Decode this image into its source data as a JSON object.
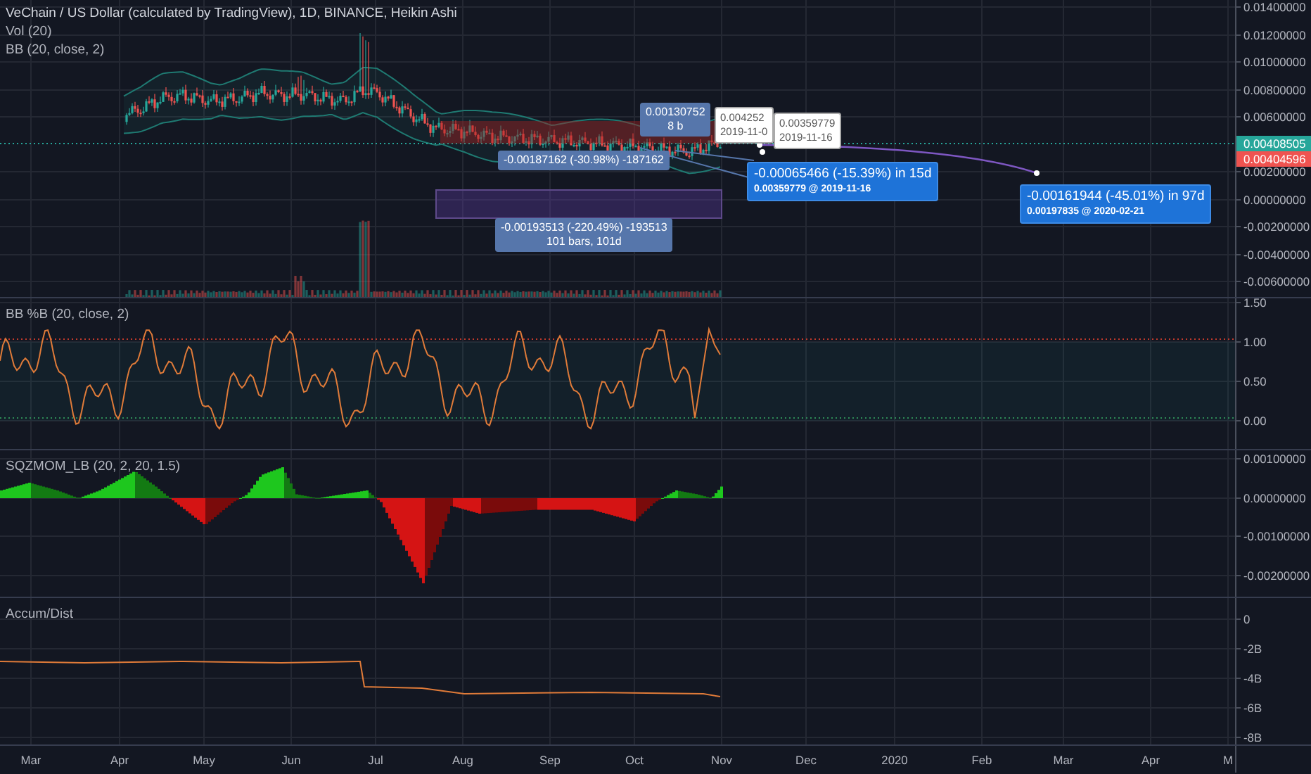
{
  "legend": {
    "title": "VeChain / US Dollar (calculated by TradingView), 1D, BINANCE, Heikin Ashi",
    "studies": [
      "Vol (20)",
      "BB (20, close, 2)"
    ]
  },
  "panes": [
    {
      "kind": "price",
      "axis_labels": [
        "0.01400000",
        "0.01200000",
        "0.01000000",
        "0.00800000",
        "0.00600000",
        "0.00200000",
        "0.00000000",
        "-0.00200000",
        "-0.00400000",
        "-0.00600000"
      ],
      "price_tags": [
        {
          "text": "0.00408505",
          "color": "#26a69a"
        },
        {
          "text": "0.00404596",
          "color": "#ef5350"
        }
      ]
    },
    {
      "kind": "percent_b",
      "title": "BB %B (20, close, 2)",
      "axis_labels": [
        "1.50",
        "1.00",
        "0.50",
        "0.00"
      ]
    },
    {
      "kind": "squeeze",
      "title": "SQZMOM_LB (20, 2, 20, 1.5)",
      "axis_labels": [
        "0.00100000",
        "0.00000000",
        "-0.00100000",
        "-0.00200000"
      ]
    },
    {
      "kind": "accum",
      "title": "Accum/Dist",
      "axis_labels": [
        "0",
        "-2B",
        "-4B",
        "-6B",
        "-8B"
      ]
    }
  ],
  "annotations": [
    {
      "kind": "measure",
      "lines": [
        "0.00130752",
        "8 b"
      ]
    },
    {
      "kind": "tooltip",
      "lines": [
        "0.004252",
        "2019-11-0"
      ]
    },
    {
      "kind": "tooltip",
      "lines": [
        "0.00359779",
        "2019-11-16"
      ]
    },
    {
      "kind": "measure",
      "lines": [
        "-0.00187162 (-30.98%) -187162"
      ]
    },
    {
      "kind": "measure",
      "lines": [
        "-0.00193513 (-220.49%) -193513",
        "101 bars, 101d"
      ]
    },
    {
      "kind": "forecast",
      "lines": [
        "-0.00065466 (-15.39%) in 15d",
        "0.00359779 @ 2019-11-16"
      ]
    },
    {
      "kind": "forecast",
      "lines": [
        "-0.00161944 (-45.01%) in 97d",
        "0.00197835 @ 2020-02-21"
      ]
    }
  ],
  "time_axis": [
    "Mar",
    "Apr",
    "May",
    "Jun",
    "Jul",
    "Aug",
    "Sep",
    "Oct",
    "Nov",
    "Dec",
    "2020",
    "Feb",
    "Mar",
    "Apr",
    "M"
  ]
}
